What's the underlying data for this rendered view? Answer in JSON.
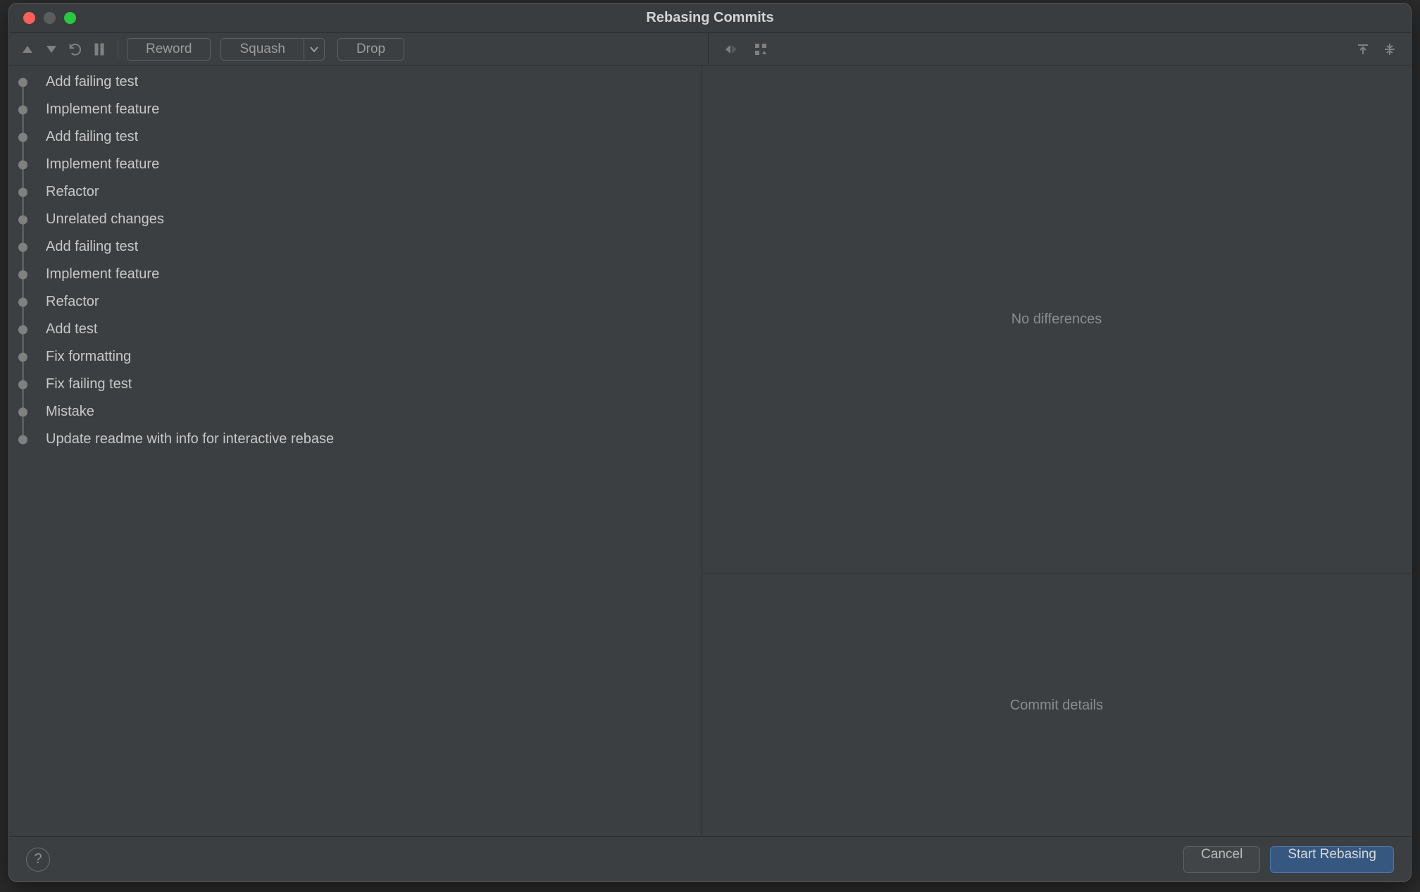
{
  "title": "Rebasing Commits",
  "toolbar": {
    "reword_label": "Reword",
    "squash_label": "Squash",
    "drop_label": "Drop"
  },
  "commits": [
    {
      "message": "Add failing test"
    },
    {
      "message": "Implement feature"
    },
    {
      "message": "Add failing test"
    },
    {
      "message": "Implement feature"
    },
    {
      "message": "Refactor"
    },
    {
      "message": "Unrelated changes"
    },
    {
      "message": "Add failing test"
    },
    {
      "message": "Implement feature"
    },
    {
      "message": "Refactor"
    },
    {
      "message": "Add test"
    },
    {
      "message": "Fix formatting"
    },
    {
      "message": "Fix failing test"
    },
    {
      "message": "Mistake"
    },
    {
      "message": "Update readme with info for interactive rebase"
    }
  ],
  "right": {
    "diff_placeholder": "No differences",
    "details_placeholder": "Commit details"
  },
  "buttons": {
    "cancel": "Cancel",
    "start": "Start Rebasing",
    "help": "?"
  }
}
